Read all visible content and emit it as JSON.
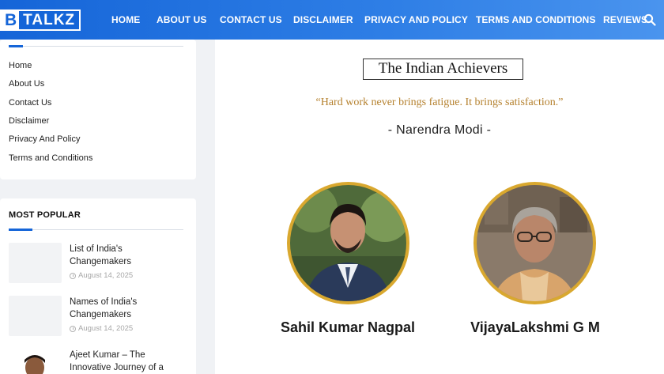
{
  "brand": {
    "logo_letter": "B",
    "logo_rest": "TALKZ"
  },
  "nav": [
    {
      "label": "HOME"
    },
    {
      "label": "ABOUT US"
    },
    {
      "label": "CONTACT US"
    },
    {
      "label": "DISCLAIMER"
    },
    {
      "label": "PRIVACY AND POLICY"
    },
    {
      "label": "TERMS AND CONDITIONS"
    },
    {
      "label": "REVIEWS"
    }
  ],
  "sidebar": {
    "links": [
      {
        "label": "Home"
      },
      {
        "label": "About Us"
      },
      {
        "label": "Contact Us"
      },
      {
        "label": "Disclaimer"
      },
      {
        "label": "Privacy And Policy"
      },
      {
        "label": "Terms and Conditions"
      }
    ],
    "popular_title": "MOST POPULAR",
    "posts": [
      {
        "title": "List of India's Changemakers",
        "date": "August 14, 2025"
      },
      {
        "title": "Names of India's Changemakers",
        "date": "August 14, 2025"
      },
      {
        "title": "Ajeet Kumar – The Innovative Journey of a",
        "date": ""
      }
    ]
  },
  "main": {
    "heading": "The Indian Achievers",
    "quote": "“Hard work never brings fatigue. It brings satisfaction.”",
    "author": "- Narendra Modi -",
    "achievers": [
      {
        "name": "Sahil Kumar Nagpal"
      },
      {
        "name": "VijayaLakshmi G M"
      }
    ]
  },
  "colors": {
    "nav_bg": "#1565d8",
    "accent_gold": "#d9a82f",
    "quote": "#b5812e"
  },
  "icons": {
    "search": "search-icon",
    "clock": "clock-icon"
  }
}
